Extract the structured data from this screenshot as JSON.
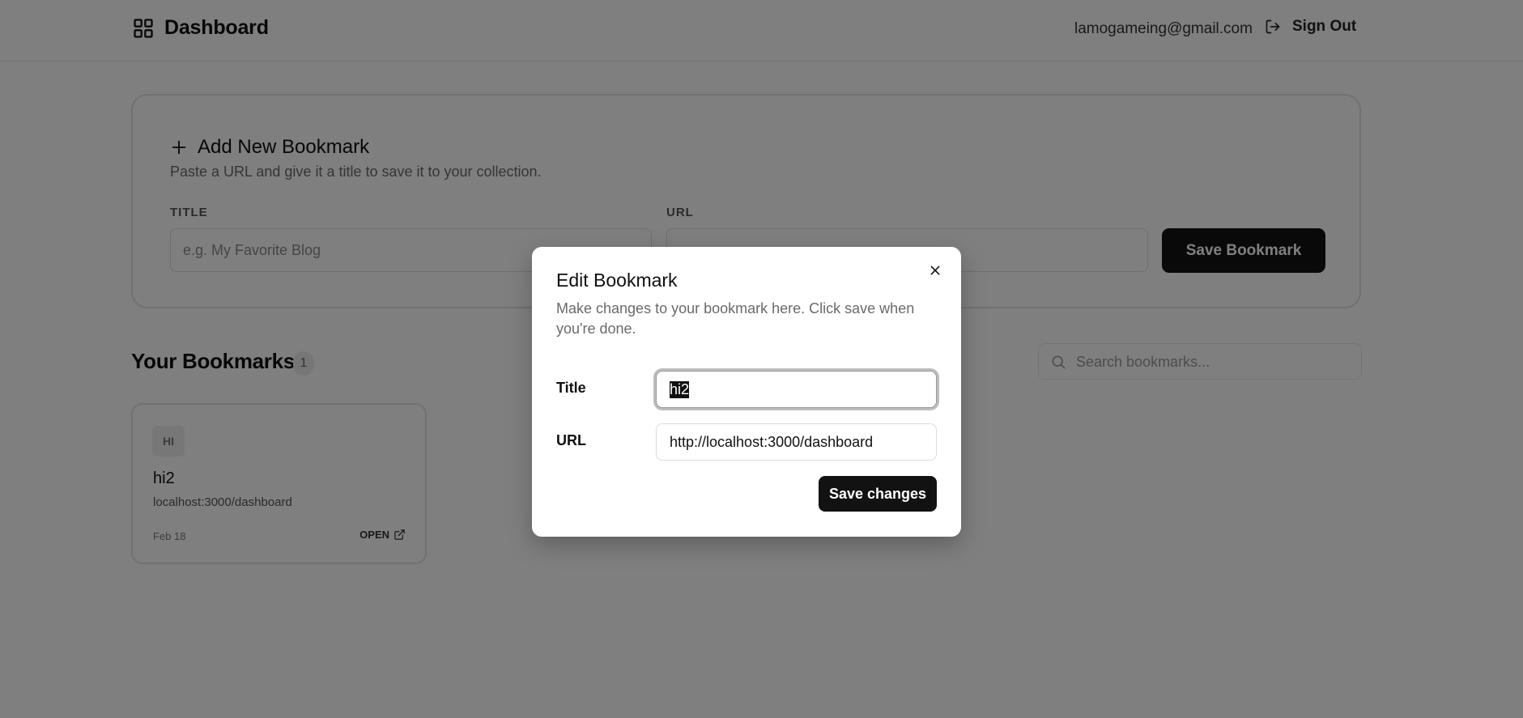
{
  "header": {
    "title": "Dashboard",
    "user_email": "lamogameing@gmail.com",
    "sign_out_label": "Sign Out",
    "brand_icon": "dashboard-grid-icon",
    "sign_out_icon": "log-out-icon"
  },
  "add_bookmark": {
    "heading": "Add New Bookmark",
    "description": "Paste a URL and give it a title to save it to your collection.",
    "title_label": "TITLE",
    "title_placeholder": "e.g. My Favorite Blog",
    "url_label": "URL",
    "url_placeholder": "",
    "save_label": "Save Bookmark"
  },
  "bookmarks": {
    "heading": "Your Bookmarks",
    "count": "1",
    "search_placeholder": "Search bookmarks...",
    "items": [
      {
        "avatar": "HI",
        "title": "hi2",
        "url": "localhost:3000/dashboard",
        "date": "Feb 18",
        "open_label": "OPEN"
      }
    ]
  },
  "edit_dialog": {
    "title": "Edit Bookmark",
    "description": "Make changes to your bookmark here. Click save when you're done.",
    "title_label": "Title",
    "title_value": "hi2",
    "url_label": "URL",
    "url_value": "http://localhost:3000/dashboard",
    "save_label": "Save changes"
  },
  "colors": {
    "primary": "#121212",
    "overlay": "rgba(0,0,0,0.5)",
    "border": "#e3e3e3",
    "muted_text": "#6a6a6a"
  }
}
